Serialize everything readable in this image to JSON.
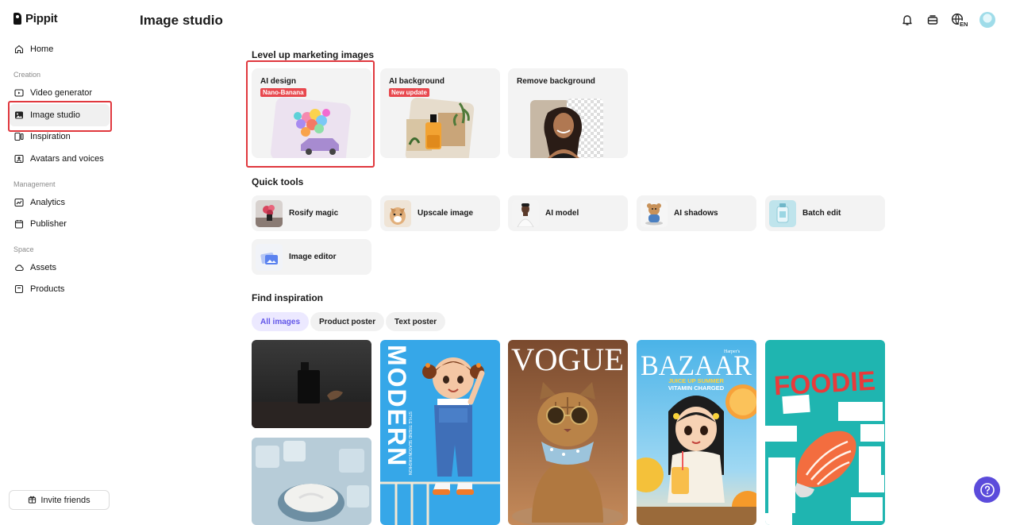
{
  "app": {
    "name": "Pippit"
  },
  "header": {
    "title": "Image studio",
    "language": "EN"
  },
  "sidebar": {
    "home": "Home",
    "sections": {
      "creation": "Creation",
      "management": "Management",
      "space": "Space"
    },
    "items": {
      "video_generator": "Video generator",
      "image_studio": "Image studio",
      "inspiration": "Inspiration",
      "avatars": "Avatars and voices",
      "analytics": "Analytics",
      "publisher": "Publisher",
      "assets": "Assets",
      "products": "Products"
    },
    "invite": "Invite friends"
  },
  "marketing": {
    "title": "Level up marketing images",
    "cards": [
      {
        "title": "AI design",
        "badge": "Nano-Banana"
      },
      {
        "title": "AI background",
        "badge": "New update"
      },
      {
        "title": "Remove background"
      }
    ]
  },
  "quick_tools": {
    "title": "Quick tools",
    "items": [
      "Rosify magic",
      "Upscale image",
      "AI model",
      "AI shadows",
      "Batch edit",
      "Image editor"
    ]
  },
  "inspiration": {
    "title": "Find inspiration",
    "filters": [
      "All images",
      "Product poster",
      "Text poster"
    ],
    "poster_texts": {
      "modern": "MODERN",
      "modern_side": "STYLE TREND SEASON FASHION",
      "vogue": "VOGUE",
      "bazaar_small": "Harper's",
      "bazaar": "BAZAAR",
      "bazaar_line1": "JUICE UP SUMMER",
      "bazaar_line2": "VITAMIN CHARGED",
      "foodie": "FOODIE"
    }
  },
  "colors": {
    "accent": "#6256e8",
    "highlight": "#e0383e",
    "badge_red": "#e8484e",
    "help": "#5b4bdb"
  }
}
